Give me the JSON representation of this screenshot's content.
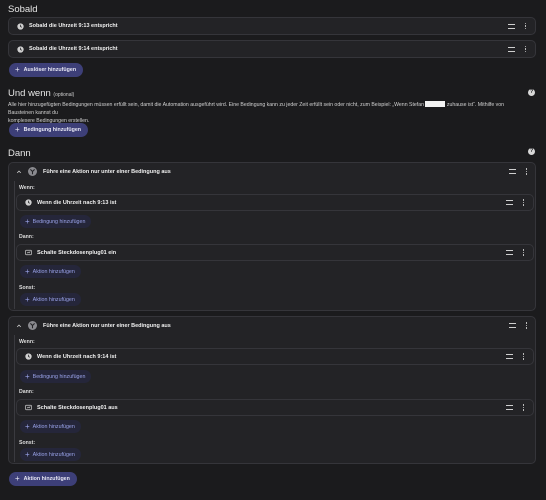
{
  "sobald": {
    "title": "Sobald",
    "triggers": [
      {
        "label": "Sobald die Uhrzeit 9:13 entspricht",
        "icon": "clock-icon"
      },
      {
        "label": "Sobald die Uhrzeit 9:14 entspricht",
        "icon": "clock-icon"
      }
    ],
    "add_trigger": "Auslöser hinzufügen"
  },
  "und_wenn": {
    "title": "Und wenn",
    "optional": "(optional)",
    "description_part1": "Alle hier hinzugefügten Bedingungen müssen erfüllt sein, damit die Automation ausgeführt wird. Eine Bedingung kann zu jeder Zeit erfüllt sein oder nicht, zum Beispiel: „Wenn Stefan",
    "description_part2": "zuhause ist“. Mithilfe von Bausteinen kannst du",
    "description_line2": "komplexere Bedingungen erstellen.",
    "add_condition": "Bedingung hinzufügen"
  },
  "dann": {
    "title": "Dann",
    "blocks": [
      {
        "header": "Führe eine Aktion nur unter einer Bedingung aus",
        "wenn_label": "Wenn:",
        "condition": "Wenn die Uhrzeit nach 9:13 ist",
        "add_condition": "Bedingung hinzufügen",
        "dann_label": "Dann:",
        "action": "Schalte Steckdosenplug01 ein",
        "add_action": "Aktion hinzufügen",
        "sonst_label": "Sonst:",
        "add_else_action": "Aktion hinzufügen"
      },
      {
        "header": "Führe eine Aktion nur unter einer Bedingung aus",
        "wenn_label": "Wenn:",
        "condition": "Wenn die Uhrzeit nach 9:14 ist",
        "add_condition": "Bedingung hinzufügen",
        "dann_label": "Dann:",
        "action": "Schalte Steckdosenplug01 aus",
        "add_action": "Aktion hinzufügen",
        "sonst_label": "Sonst:",
        "add_else_action": "Aktion hinzufügen"
      }
    ],
    "add_action": "Aktion hinzufügen"
  },
  "help_symbol": "?",
  "plus_symbol": "+",
  "colors": {
    "background": "#1b1b1d",
    "card": "#232326",
    "accent": "#3d3f78",
    "link": "#9aa3ea"
  }
}
